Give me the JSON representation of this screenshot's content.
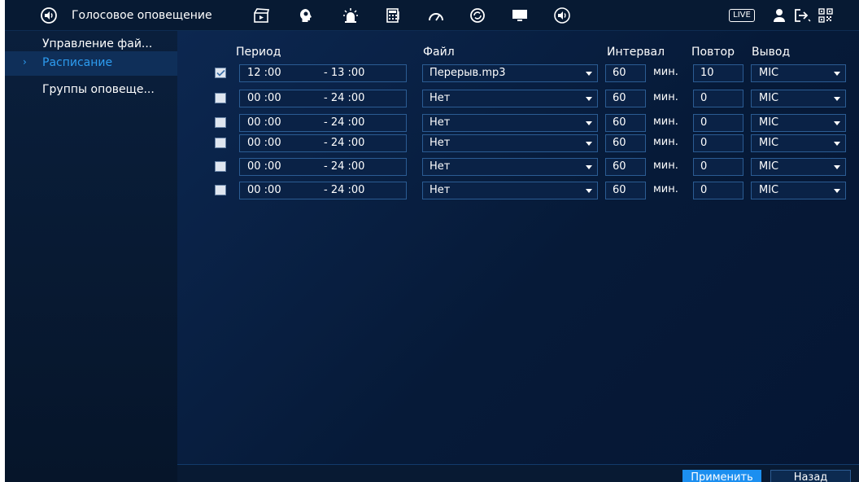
{
  "header": {
    "title": "Голосовое оповещение",
    "icons": [
      "speaker-icon",
      "clapperboard-icon",
      "head-gear-icon",
      "alarm-light-icon",
      "calculator-icon",
      "gauge-icon",
      "refresh-circle-icon",
      "monitor-icon",
      "speaker-icon",
      "live-icon",
      "user-icon",
      "logout-icon",
      "qr-code-icon"
    ],
    "live_label": "LIVE"
  },
  "sidebar": {
    "items": [
      {
        "label": "Управление фай...",
        "active": false
      },
      {
        "label": "Расписание",
        "active": true
      },
      {
        "label": "Группы оповеще...",
        "active": false
      }
    ]
  },
  "table": {
    "headers": {
      "period": "Период",
      "file": "Файл",
      "interval": "Интервал",
      "repeat": "Повтор",
      "output": "Вывод"
    },
    "unit": "мин.",
    "rows": [
      {
        "checked": true,
        "start": "12 :00",
        "end": "- 13 :00",
        "file": "Перерыв.mp3",
        "interval": "60",
        "repeat": "10",
        "output": "MIC"
      },
      {
        "checked": false,
        "start": "00 :00",
        "end": "- 24 :00",
        "file": "Нет",
        "interval": "60",
        "repeat": "0",
        "output": "MIC"
      },
      {
        "checked": false,
        "start": "00 :00",
        "end": "- 24 :00",
        "file": "Нет",
        "interval": "60",
        "repeat": "0",
        "output": "MIC"
      },
      {
        "checked": false,
        "start": "00 :00",
        "end": "- 24 :00",
        "file": "Нет",
        "interval": "60",
        "repeat": "0",
        "output": "MIC"
      },
      {
        "checked": false,
        "start": "00 :00",
        "end": "- 24 :00",
        "file": "Нет",
        "interval": "60",
        "repeat": "0",
        "output": "MIC"
      },
      {
        "checked": false,
        "start": "00 :00",
        "end": "- 24 :00",
        "file": "Нет",
        "interval": "60",
        "repeat": "0",
        "output": "MIC"
      }
    ]
  },
  "footer": {
    "apply_label": "Применить",
    "back_label": "Назад"
  },
  "colors": {
    "accent": "#1c8ff0",
    "active_text": "#2d9cf0",
    "background": "#071a33"
  }
}
